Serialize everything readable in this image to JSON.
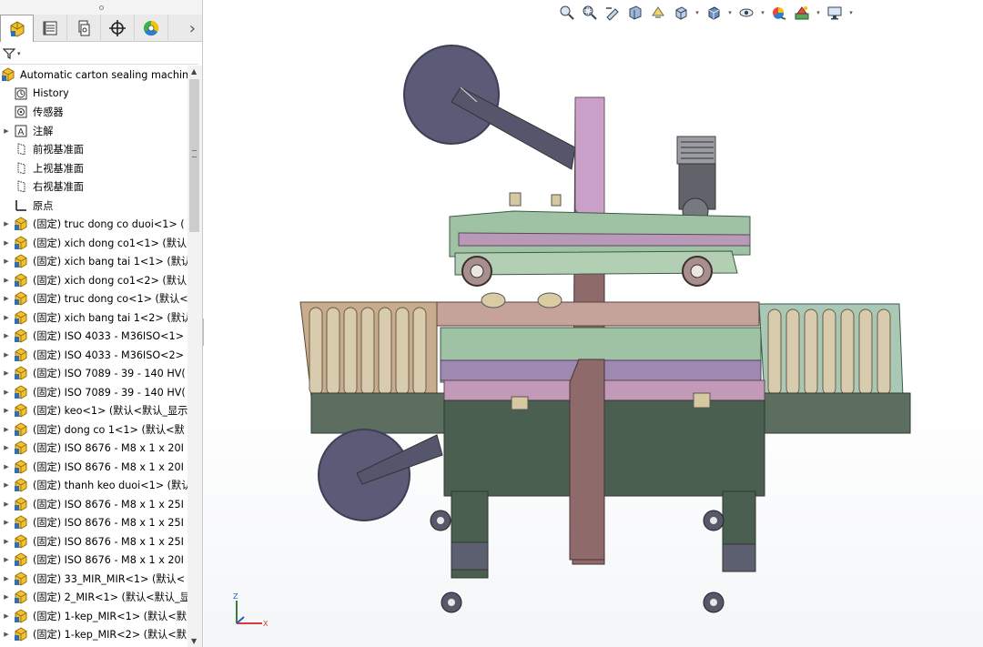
{
  "panel_tabs": [
    {
      "name": "feature-manager-tab",
      "icon": "assembly-icon",
      "active": true
    },
    {
      "name": "property-manager-tab",
      "icon": "property-list-icon"
    },
    {
      "name": "configuration-manager-tab",
      "icon": "configuration-icon"
    },
    {
      "name": "dimxpert-tab",
      "icon": "crosshair-icon"
    },
    {
      "name": "display-manager-tab",
      "icon": "color-wheel-icon"
    }
  ],
  "filter": {
    "icon": "filter-icon"
  },
  "tree": {
    "root": "Automatic carton sealing machine",
    "items": [
      {
        "label": "History",
        "icon": "history-icon",
        "expandable": false
      },
      {
        "label": "传感器",
        "icon": "sensor-icon",
        "expandable": false
      },
      {
        "label": "注解",
        "icon": "annotation-icon",
        "expandable": true
      },
      {
        "label": "前视基准面",
        "icon": "plane-icon",
        "expandable": false
      },
      {
        "label": "上视基准面",
        "icon": "plane-icon",
        "expandable": false
      },
      {
        "label": "右视基准面",
        "icon": "plane-icon",
        "expandable": false
      },
      {
        "label": "原点",
        "icon": "origin-icon",
        "expandable": false
      },
      {
        "label": "(固定) truc dong co duoi<1> (",
        "icon": "part-icon",
        "expandable": true
      },
      {
        "label": "(固定) xich dong co1<1> (默认",
        "icon": "part-icon",
        "expandable": true
      },
      {
        "label": "(固定) xich bang tai 1<1> (默认",
        "icon": "part-icon",
        "expandable": true
      },
      {
        "label": "(固定) xich dong co1<2> (默认",
        "icon": "part-icon",
        "expandable": true
      },
      {
        "label": "(固定) truc dong co<1> (默认<",
        "icon": "part-icon",
        "expandable": true
      },
      {
        "label": "(固定) xich bang tai 1<2> (默认",
        "icon": "part-icon",
        "expandable": true
      },
      {
        "label": "(固定) ISO 4033 - M36ISO<1>",
        "icon": "part-icon",
        "expandable": true
      },
      {
        "label": "(固定) ISO 4033 - M36ISO<2>",
        "icon": "part-icon",
        "expandable": true
      },
      {
        "label": "(固定) ISO 7089 - 39 - 140 HV(",
        "icon": "part-icon",
        "expandable": true
      },
      {
        "label": "(固定) ISO 7089 - 39 - 140 HV(",
        "icon": "part-icon",
        "expandable": true
      },
      {
        "label": "(固定) keo<1> (默认<默认_显示",
        "icon": "part-icon",
        "expandable": true
      },
      {
        "label": "(固定) dong co 1<1> (默认<默",
        "icon": "part-icon",
        "expandable": true
      },
      {
        "label": "(固定) ISO 8676 - M8 x 1 x 20I",
        "icon": "part-icon",
        "expandable": true
      },
      {
        "label": "(固定) ISO 8676 - M8 x 1 x 20I",
        "icon": "part-icon",
        "expandable": true
      },
      {
        "label": "(固定) thanh keo duoi<1> (默认",
        "icon": "part-icon",
        "expandable": true
      },
      {
        "label": "(固定) ISO 8676 - M8 x 1 x 25I",
        "icon": "part-icon",
        "expandable": true
      },
      {
        "label": "(固定) ISO 8676 - M8 x 1 x 25I",
        "icon": "part-icon",
        "expandable": true
      },
      {
        "label": "(固定) ISO 8676 - M8 x 1 x 25I",
        "icon": "part-icon",
        "expandable": true
      },
      {
        "label": "(固定) ISO 8676 - M8 x 1 x 20I",
        "icon": "part-icon",
        "expandable": true
      },
      {
        "label": "(固定) 33_MIR_MIR<1> (默认<",
        "icon": "part-icon",
        "expandable": true
      },
      {
        "label": "(固定) 2_MIR<1> (默认<默认_显",
        "icon": "part-icon",
        "expandable": true
      },
      {
        "label": "(固定) 1-kep_MIR<1> (默认<默",
        "icon": "part-icon",
        "expandable": true
      },
      {
        "label": "(固定) 1-kep_MIR<2> (默认<默",
        "icon": "part-icon",
        "expandable": true
      }
    ]
  },
  "heads_up_toolbar": [
    {
      "name": "zoom-to-fit-icon"
    },
    {
      "name": "zoom-to-area-icon"
    },
    {
      "name": "previous-view-icon"
    },
    {
      "name": "section-view-icon"
    },
    {
      "name": "dynamic-annotation-icon"
    },
    {
      "name": "view-orientation-icon",
      "dropdown": true
    },
    {
      "name": "display-style-icon",
      "dropdown": true
    },
    {
      "name": "hide-show-items-icon",
      "dropdown": true
    },
    {
      "name": "edit-appearance-icon"
    },
    {
      "name": "apply-scene-icon",
      "dropdown": true
    },
    {
      "name": "view-settings-icon",
      "dropdown": true
    }
  ],
  "colors": {
    "part_icon_yellow": "#f3c12e",
    "part_icon_blue": "#2f6fb5",
    "frame_green": "#4a5e4e",
    "guide_pink": "#b98fb2",
    "roller_tan": "#d4c4a6",
    "tape_disc": "#595a74"
  }
}
